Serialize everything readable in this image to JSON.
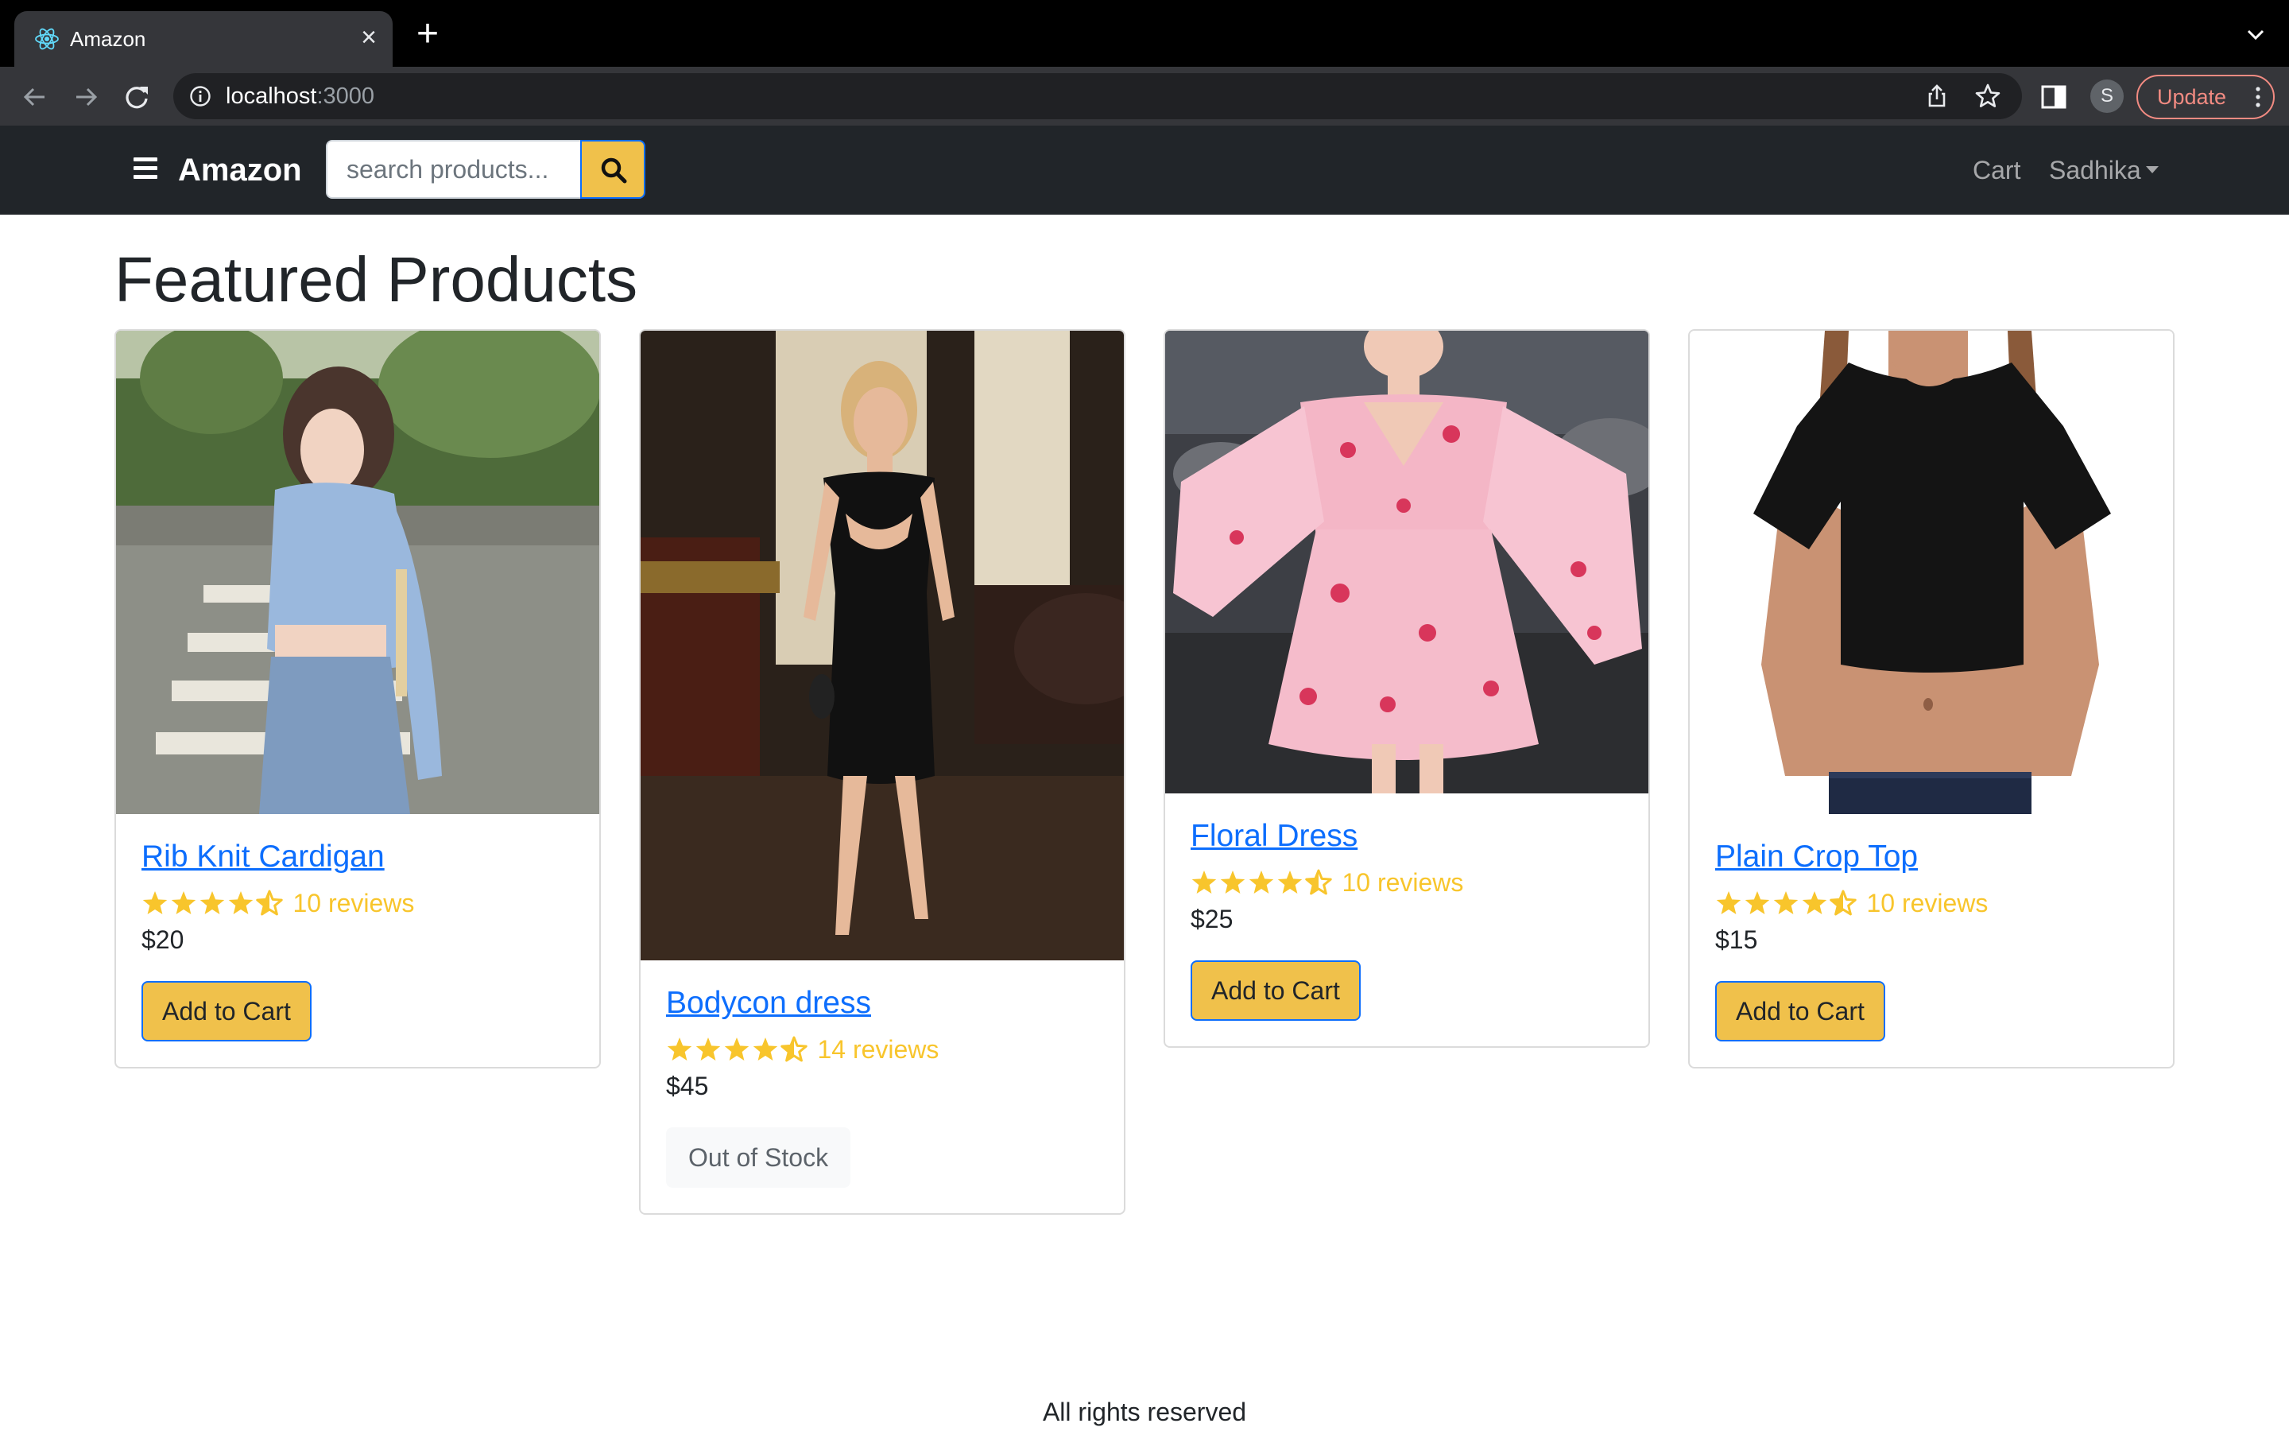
{
  "browser": {
    "tab_title": "Amazon",
    "url_host": "localhost",
    "url_port": ":3000",
    "profile_initial": "S",
    "update_label": "Update"
  },
  "navbar": {
    "brand": "Amazon",
    "search_placeholder": "search products...",
    "cart_label": "Cart",
    "user_label": "Sadhika"
  },
  "main": {
    "heading": "Featured Products",
    "products": [
      {
        "name": "Rib Knit Cardigan",
        "rating": 4.5,
        "reviews": "10 reviews",
        "price": "$20",
        "action": "Add to Cart",
        "in_stock": true
      },
      {
        "name": "Bodycon dress",
        "rating": 4.5,
        "reviews": "14 reviews",
        "price": "$45",
        "action": "Out of Stock",
        "in_stock": false
      },
      {
        "name": "Floral Dress",
        "rating": 4.5,
        "reviews": "10 reviews",
        "price": "$25",
        "action": "Add to Cart",
        "in_stock": true
      },
      {
        "name": "Plain Crop Top",
        "rating": 4.5,
        "reviews": "10 reviews",
        "price": "$15",
        "action": "Add to Cart",
        "in_stock": true
      }
    ]
  },
  "footer": {
    "text": "All rights reserved"
  },
  "colors": {
    "brand_bar": "#212529",
    "button_yellow": "#f0c14b",
    "star": "#f8c52c",
    "link": "#0d6efd"
  }
}
